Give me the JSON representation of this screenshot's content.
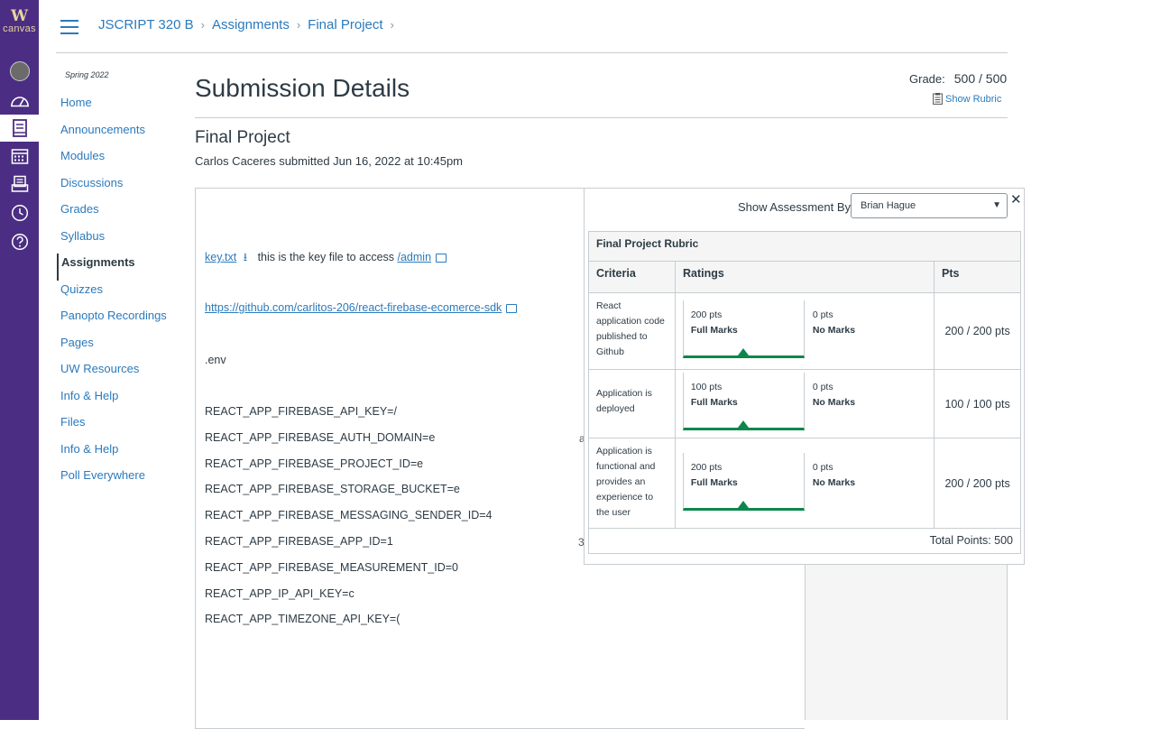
{
  "brand": {
    "logo_letter": "W",
    "logo_word": "canvas"
  },
  "breadcrumb": [
    "JSCRIPT 320 B",
    "Assignments",
    "Final Project"
  ],
  "course_nav": {
    "term": "Spring 2022",
    "items": [
      "Home",
      "Announcements",
      "Modules",
      "Discussions",
      "Grades",
      "Syllabus",
      "Assignments",
      "Quizzes",
      "Panopto Recordings",
      "Pages",
      "UW Resources",
      "Info & Help",
      "Files",
      "Info & Help",
      "Poll Everywhere"
    ],
    "active": "Assignments"
  },
  "page": {
    "title": "Submission Details",
    "grade_label": "Grade:",
    "grade_value": "500 / 500",
    "show_rubric": "Show Rubric",
    "assignment_title": "Final Project",
    "submitted_info": "Carlos Caceres submitted Jun 16, 2022 at 10:45pm"
  },
  "document": {
    "key_link": "key.txt",
    "key_desc": "this is the key file to access",
    "admin_link": "/admin",
    "github_link": "https://github.com/carlitos-206/react-firebase-ecomerce-sdk",
    "env": ".env",
    "env_lines": [
      "REACT_APP_FIREBASE_API_KEY=/",
      "REACT_APP_FIREBASE_AUTH_DOMAIN=e",
      "REACT_APP_FIREBASE_PROJECT_ID=e",
      "REACT_APP_FIREBASE_STORAGE_BUCKET=e",
      "REACT_APP_FIREBASE_MESSAGING_SENDER_ID=4",
      "REACT_APP_FIREBASE_APP_ID=1",
      "REACT_APP_FIREBASE_MEASUREMENT_ID=0",
      "REACT_APP_IP_API_KEY=c",
      "REACT_APP_TIMEZONE_API_KEY=("
    ],
    "stray_1": "a",
    "stray_2": "3"
  },
  "rubric": {
    "assessment_label": "Show Assessment By:",
    "assessor": "Brian Hague",
    "title": "Final Project Rubric",
    "headers": {
      "criteria": "Criteria",
      "ratings": "Ratings",
      "pts": "Pts"
    },
    "rows": [
      {
        "criteria": "React application code published to Github",
        "full_pts": "200 pts",
        "full_label": "Full Marks",
        "zero_pts": "0 pts",
        "zero_label": "No Marks",
        "score": "200 / 200 pts"
      },
      {
        "criteria": "Application is deployed",
        "full_pts": "100 pts",
        "full_label": "Full Marks",
        "zero_pts": "0 pts",
        "zero_label": "No Marks",
        "score": "100 / 100 pts"
      },
      {
        "criteria": "Application is functional and provides an experience to the user",
        "full_pts": "200 pts",
        "full_label": "Full Marks",
        "zero_pts": "0 pts",
        "zero_label": "No Marks",
        "score": "200 / 200 pts"
      }
    ],
    "total": "Total Points: 500"
  }
}
